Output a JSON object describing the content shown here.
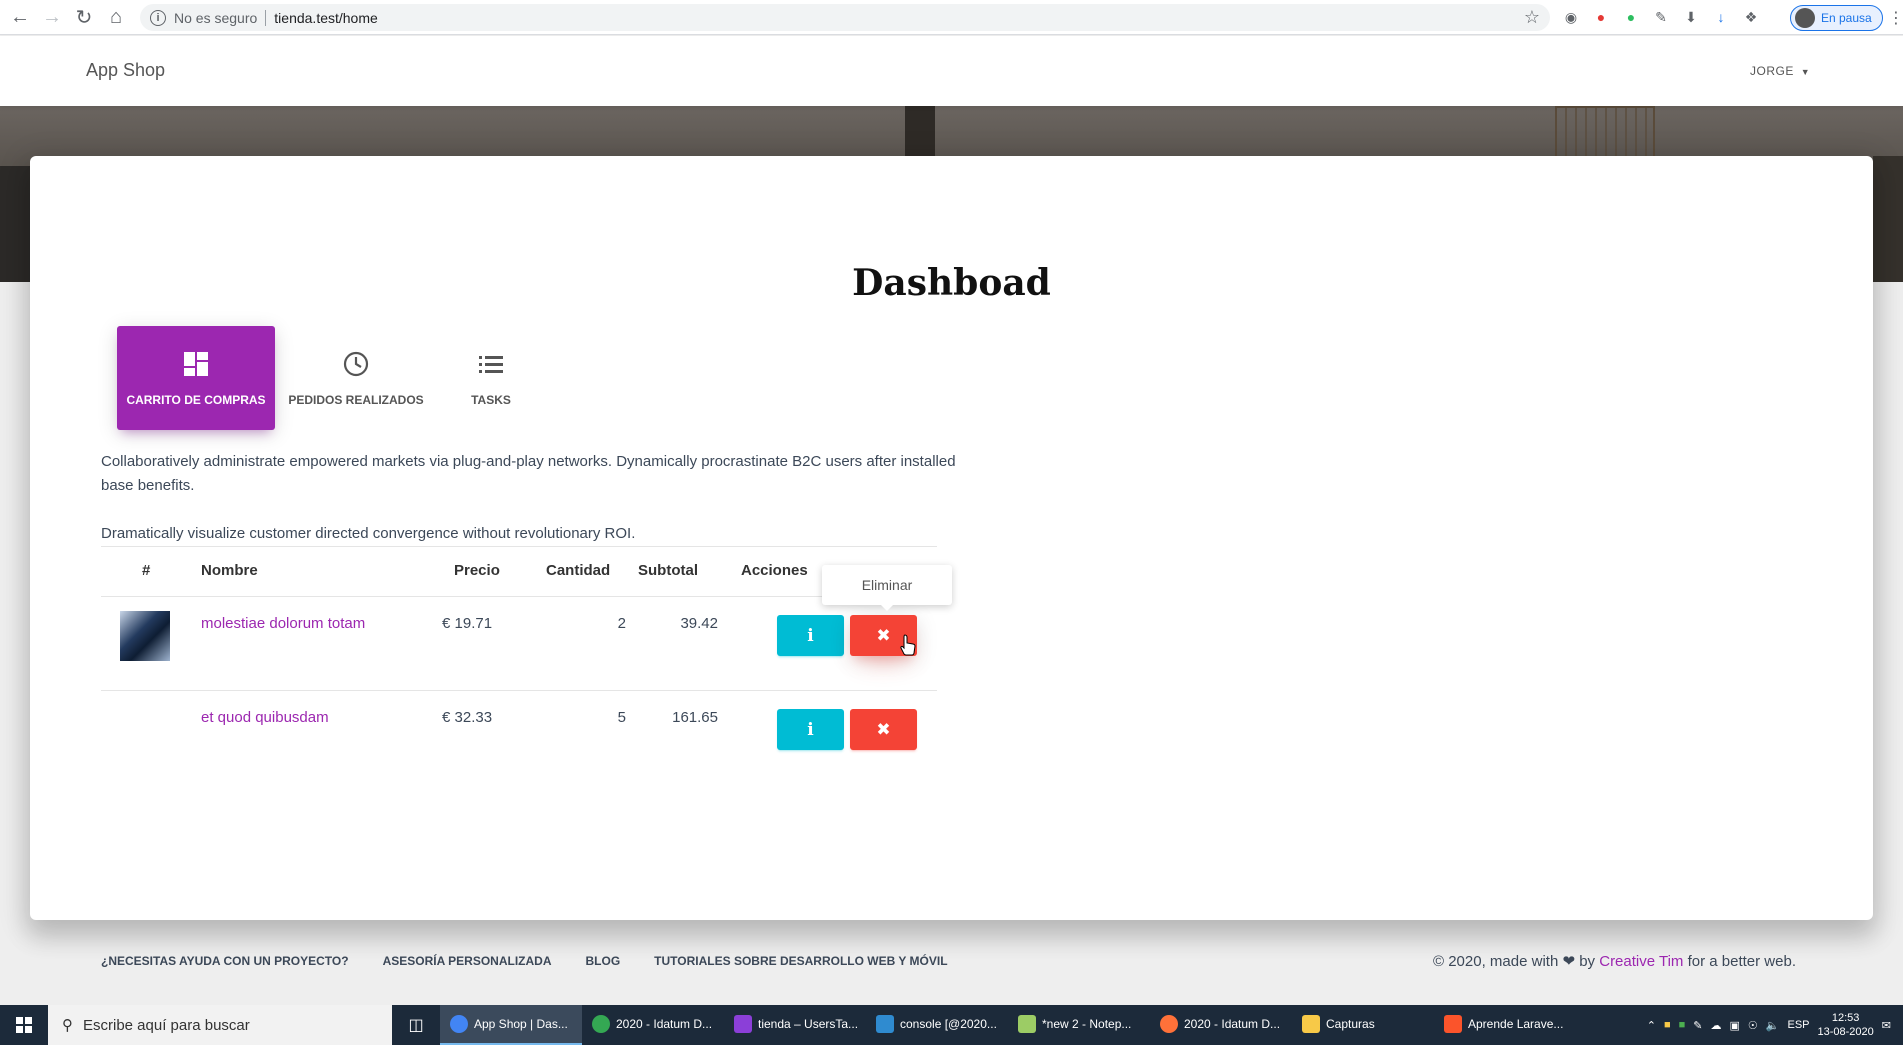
{
  "browser": {
    "security_label": "No es seguro",
    "url": "tienda.test/home",
    "profile_label": "En pausa"
  },
  "app": {
    "brand": "App Shop",
    "user_menu": "JORGE"
  },
  "page": {
    "title": "Dashboad",
    "tabs": [
      {
        "label": "CARRITO DE COMPRAS",
        "icon": "dashboard-icon",
        "active": true
      },
      {
        "label": "PEDIDOS REALIZADOS",
        "icon": "clock-icon",
        "active": false
      },
      {
        "label": "TASKS",
        "icon": "list-icon",
        "active": false
      }
    ],
    "description": [
      "Collaboratively administrate empowered markets via plug-and-play networks. Dynamically procrastinate B2C users after installed base benefits.",
      "Dramatically visualize customer directed convergence without revolutionary ROI."
    ]
  },
  "table": {
    "headers": [
      "#",
      "Nombre",
      "Precio",
      "Cantidad",
      "Subtotal",
      "Acciones"
    ],
    "rows": [
      {
        "name": "molestiae dolorum totam",
        "price": "€ 19.71",
        "quantity": "2",
        "subtotal": "39.42",
        "has_image": true
      },
      {
        "name": "et quod quibusdam",
        "price": "€ 32.33",
        "quantity": "5",
        "subtotal": "161.65",
        "has_image": false
      }
    ],
    "info_icon": "i",
    "delete_icon": "✖",
    "tooltip": "Eliminar"
  },
  "footer": {
    "links": [
      "¿NECESITAS AYUDA CON UN PROYECTO?",
      "ASESORÍA PERSONALIZADA",
      "BLOG",
      "TUTORIALES SOBRE DESARROLLO WEB Y MÓVIL"
    ],
    "copy_prefix": "© 2020, made with",
    "copy_by": "by",
    "copy_author": "Creative Tim",
    "copy_suffix": "for a better web."
  },
  "taskbar": {
    "search_placeholder": "Escribe aquí para buscar",
    "tasks": [
      {
        "label": "App Shop | Das...",
        "active": true
      },
      {
        "label": "2020 - Idatum D...",
        "active": false
      },
      {
        "label": "tienda – UsersTa...",
        "active": false
      },
      {
        "label": "console [@2020...",
        "active": false
      },
      {
        "label": "*new 2 - Notep...",
        "active": false
      },
      {
        "label": "2020 - Idatum D...",
        "active": false
      },
      {
        "label": "Capturas",
        "active": false
      },
      {
        "label": "Aprende Larave...",
        "active": false
      }
    ],
    "language": "ESP",
    "time": "12:53",
    "date": "13-08-2020"
  },
  "colors": {
    "primary": "#9c27b0",
    "info": "#00bcd4",
    "danger": "#f44336"
  }
}
